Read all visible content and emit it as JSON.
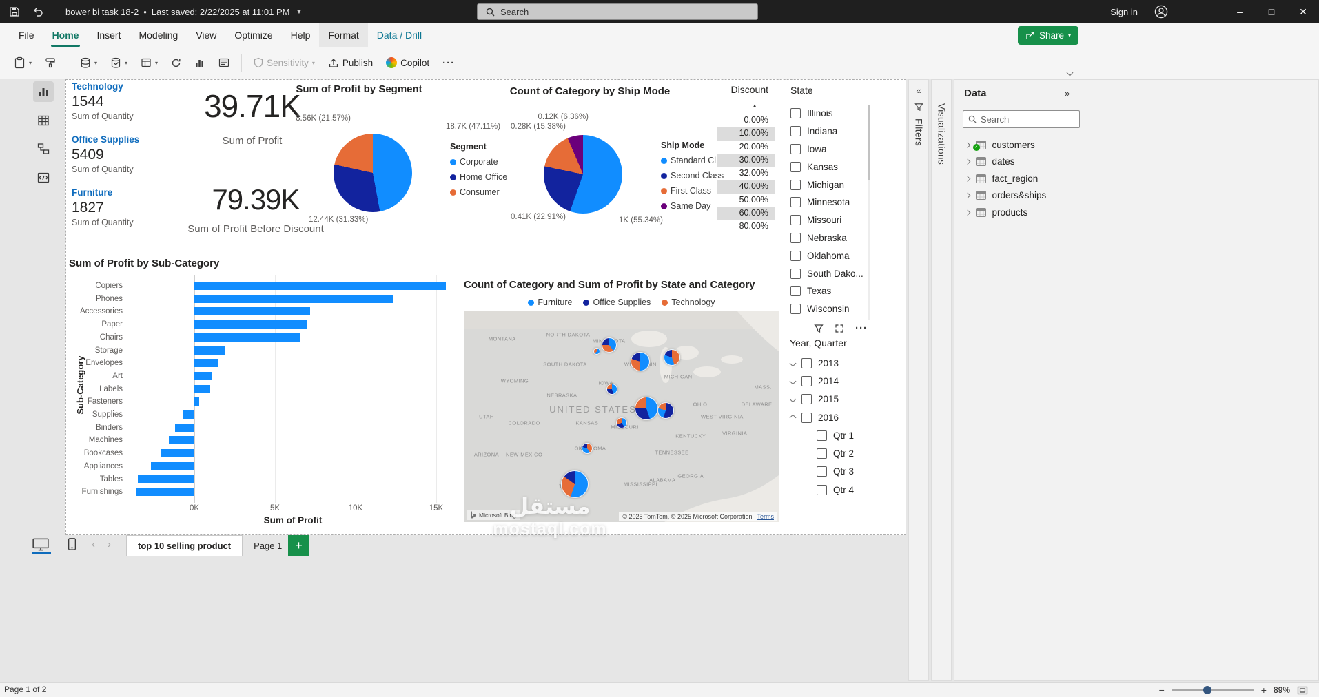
{
  "titlebar": {
    "title": "bower bi task 18-2",
    "separator": "•",
    "last_saved": "Last saved: 2/22/2025 at 11:01 PM",
    "search_placeholder": "Search",
    "sign_in": "Sign in"
  },
  "ribbon": {
    "tabs": [
      {
        "label": "File"
      },
      {
        "label": "Home",
        "active": true
      },
      {
        "label": "Insert"
      },
      {
        "label": "Modeling"
      },
      {
        "label": "View"
      },
      {
        "label": "Optimize"
      },
      {
        "label": "Help"
      },
      {
        "label": "Format",
        "contextual": true
      },
      {
        "label": "Data / Drill",
        "contextual_text": true
      }
    ],
    "share_label": "Share"
  },
  "toolbar": {
    "sensitivity_label": "Sensitivity",
    "publish_label": "Publish",
    "copilot_label": "Copilot"
  },
  "category_cards": [
    {
      "title": "Technology",
      "value": "1544",
      "label": "Sum of Quantity"
    },
    {
      "title": "Office Supplies",
      "value": "5409",
      "label": "Sum of Quantity"
    },
    {
      "title": "Furniture",
      "value": "1827",
      "label": "Sum of Quantity"
    }
  ],
  "kpi_cards": [
    {
      "value": "39.71K",
      "label": "Sum of Profit"
    },
    {
      "value": "79.39K",
      "label": "Sum of Profit Before Discount"
    }
  ],
  "chart_data": [
    {
      "type": "pie",
      "title": "Sum of Profit by Segment",
      "legend_title": "Segment",
      "legend_position": "right",
      "slices": [
        {
          "label": "Corporate",
          "value": 18.7,
          "pct": 47.11,
          "value_label": "18.7K (47.11%)",
          "color": "#118DFF"
        },
        {
          "label": "Home Office",
          "value": 12.44,
          "pct": 31.33,
          "value_label": "12.44K (31.33%)",
          "color": "#12239E"
        },
        {
          "label": "Consumer",
          "value": 8.56,
          "pct": 21.57,
          "value_label": "8.56K (21.57%)",
          "color": "#E66C37"
        }
      ]
    },
    {
      "type": "pie",
      "title": "Count of Category by Ship Mode",
      "legend_title": "Ship Mode",
      "legend_position": "right",
      "slices": [
        {
          "label": "Standard Cl...",
          "value": 1.0,
          "pct": 55.34,
          "value_label": "1K (55.34%)",
          "color": "#118DFF"
        },
        {
          "label": "Second Class",
          "value": 0.41,
          "pct": 22.91,
          "value_label": "0.41K (22.91%)",
          "color": "#12239E"
        },
        {
          "label": "First Class",
          "value": 0.28,
          "pct": 15.38,
          "value_label": "0.28K (15.38%)",
          "color": "#E66C37"
        },
        {
          "label": "Same Day",
          "value": 0.12,
          "pct": 6.36,
          "value_label": "0.12K (6.36%)",
          "color": "#6B007B"
        }
      ]
    },
    {
      "type": "bar",
      "title": "Sum of Profit by Sub-Category",
      "xlabel": "Sum of Profit",
      "ylabel": "Sub-Category",
      "orientation": "horizontal",
      "bar_color": "#118DFF",
      "ticks": [
        0,
        5,
        10,
        15
      ],
      "tick_suffix": "K",
      "xlim": [
        -4,
        16.5
      ],
      "categories": [
        "Copiers",
        "Phones",
        "Accessories",
        "Paper",
        "Chairs",
        "Storage",
        "Envelopes",
        "Art",
        "Labels",
        "Fasteners",
        "Supplies",
        "Binders",
        "Machines",
        "Bookcases",
        "Appliances",
        "Tables",
        "Furnishings"
      ],
      "values": [
        15.6,
        12.3,
        7.2,
        7.0,
        6.6,
        1.9,
        1.5,
        1.1,
        1.0,
        0.3,
        -0.7,
        -1.2,
        -1.6,
        -2.1,
        -2.7,
        -3.5,
        -3.6
      ]
    },
    {
      "type": "map",
      "title": "Count of Category and Sum of Profit by State and Category",
      "big_label": "UNITED STATES",
      "provider": "Microsoft Bing",
      "attribution": "© 2025 TomTom, © 2025 Microsoft Corporation",
      "terms": "Terms",
      "legend": [
        {
          "label": "Furniture",
          "color": "#118DFF"
        },
        {
          "label": "Office Supplies",
          "color": "#12239E"
        },
        {
          "label": "Technology",
          "color": "#E66C37"
        }
      ],
      "state_labels": [
        {
          "text": "MONTANA",
          "x": 12,
          "y": 13
        },
        {
          "text": "NORTH DAKOTA",
          "x": 33,
          "y": 11
        },
        {
          "text": "MINNESOTA",
          "x": 46,
          "y": 14
        },
        {
          "text": "SOUTH DAKOTA",
          "x": 32,
          "y": 25
        },
        {
          "text": "WISCONSIN",
          "x": 56,
          "y": 25
        },
        {
          "text": "MICHIGAN",
          "x": 68,
          "y": 31
        },
        {
          "text": "WYOMING",
          "x": 16,
          "y": 33
        },
        {
          "text": "IOWA",
          "x": 45,
          "y": 34
        },
        {
          "text": "NEBRASKA",
          "x": 31,
          "y": 40
        },
        {
          "text": "OHIO",
          "x": 75,
          "y": 44
        },
        {
          "text": "UTAH",
          "x": 7,
          "y": 50
        },
        {
          "text": "COLORADO",
          "x": 19,
          "y": 53
        },
        {
          "text": "KANSAS",
          "x": 39,
          "y": 53
        },
        {
          "text": "MISSOURI",
          "x": 51,
          "y": 55
        },
        {
          "text": "KENTUCKY",
          "x": 72,
          "y": 59
        },
        {
          "text": "WEST VIRGINIA",
          "x": 82,
          "y": 50
        },
        {
          "text": "VIRGINIA",
          "x": 86,
          "y": 58
        },
        {
          "text": "DELAWARE",
          "x": 93,
          "y": 44
        },
        {
          "text": "MASS.",
          "x": 95,
          "y": 36
        },
        {
          "text": "ARIZONA",
          "x": 7,
          "y": 68
        },
        {
          "text": "NEW MEXICO",
          "x": 19,
          "y": 68
        },
        {
          "text": "OKLAHOMA",
          "x": 40,
          "y": 65
        },
        {
          "text": "TENNESSEE",
          "x": 66,
          "y": 67
        },
        {
          "text": "MISSISSIPPI",
          "x": 56,
          "y": 82
        },
        {
          "text": "ALABAMA",
          "x": 63,
          "y": 80
        },
        {
          "text": "GEORGIA",
          "x": 72,
          "y": 78
        },
        {
          "text": "TEXAS",
          "x": 33,
          "y": 83
        }
      ],
      "markers": [
        {
          "x": 46,
          "y": 16,
          "d": 22,
          "segments": [
            [
              "#118DFF",
              40
            ],
            [
              "#E66C37",
              35
            ],
            [
              "#12239E",
              25
            ]
          ]
        },
        {
          "x": 42,
          "y": 19,
          "d": 10,
          "segments": [
            [
              "#118DFF",
              60
            ],
            [
              "#E66C37",
              40
            ]
          ]
        },
        {
          "x": 56,
          "y": 24,
          "d": 28,
          "segments": [
            [
              "#118DFF",
              50
            ],
            [
              "#E66C37",
              30
            ],
            [
              "#12239E",
              20
            ]
          ]
        },
        {
          "x": 66,
          "y": 22,
          "d": 24,
          "segments": [
            [
              "#E66C37",
              45
            ],
            [
              "#118DFF",
              35
            ],
            [
              "#12239E",
              20
            ]
          ]
        },
        {
          "x": 47,
          "y": 37,
          "d": 16,
          "segments": [
            [
              "#118DFF",
              45
            ],
            [
              "#12239E",
              30
            ],
            [
              "#E66C37",
              25
            ]
          ]
        },
        {
          "x": 58,
          "y": 46,
          "d": 34,
          "segments": [
            [
              "#118DFF",
              45
            ],
            [
              "#12239E",
              30
            ],
            [
              "#E66C37",
              25
            ]
          ]
        },
        {
          "x": 64,
          "y": 47,
          "d": 24,
          "segments": [
            [
              "#12239E",
              55
            ],
            [
              "#118DFF",
              25
            ],
            [
              "#E66C37",
              20
            ]
          ]
        },
        {
          "x": 50,
          "y": 53,
          "d": 16,
          "segments": [
            [
              "#118DFF",
              40
            ],
            [
              "#12239E",
              30
            ],
            [
              "#E66C37",
              30
            ]
          ]
        },
        {
          "x": 39,
          "y": 65,
          "d": 16,
          "segments": [
            [
              "#E66C37",
              40
            ],
            [
              "#118DFF",
              40
            ],
            [
              "#12239E",
              20
            ]
          ]
        },
        {
          "x": 35,
          "y": 82,
          "d": 40,
          "segments": [
            [
              "#118DFF",
              55
            ],
            [
              "#E66C37",
              30
            ],
            [
              "#12239E",
              15
            ]
          ]
        }
      ]
    }
  ],
  "discount_slicer": {
    "title": "Discount",
    "sort_icon": "▲",
    "values": [
      {
        "label": "0.00%",
        "selected": false
      },
      {
        "label": "10.00%",
        "selected": true
      },
      {
        "label": "20.00%",
        "selected": false
      },
      {
        "label": "30.00%",
        "selected": true
      },
      {
        "label": "32.00%",
        "selected": false
      },
      {
        "label": "40.00%",
        "selected": true
      },
      {
        "label": "50.00%",
        "selected": false
      },
      {
        "label": "60.00%",
        "selected": true
      },
      {
        "label": "80.00%",
        "selected": false
      }
    ]
  },
  "state_slicer": {
    "title": "State",
    "items": [
      "Illinois",
      "Indiana",
      "Iowa",
      "Kansas",
      "Michigan",
      "Minnesota",
      "Missouri",
      "Nebraska",
      "Oklahoma",
      "South Dako...",
      "Texas",
      "Wisconsin"
    ]
  },
  "year_slicer": {
    "title": "Year, Quarter",
    "items": [
      {
        "label": "2013",
        "chevron": "down"
      },
      {
        "label": "2014",
        "chevron": "down"
      },
      {
        "label": "2015",
        "chevron": "down"
      },
      {
        "label": "2016",
        "chevron": "up"
      },
      {
        "label": "Qtr 1",
        "indent": true
      },
      {
        "label": "Qtr 2",
        "indent": true
      },
      {
        "label": "Qtr 3",
        "indent": true
      },
      {
        "label": "Qtr 4",
        "indent": true
      }
    ]
  },
  "panes": {
    "filters_label": "Filters",
    "visualizations_label": "Visualizations",
    "data": {
      "title": "Data",
      "search_placeholder": "Search",
      "tables": [
        {
          "name": "customers",
          "checked": true
        },
        {
          "name": "dates",
          "checked": false
        },
        {
          "name": "fact_region",
          "checked": false
        },
        {
          "name": "orders&ships",
          "checked": false
        },
        {
          "name": "products",
          "checked": false
        }
      ]
    }
  },
  "pages_bar": {
    "tabs": [
      {
        "label": "top 10 selling product",
        "active": true
      },
      {
        "label": "Page 1",
        "active": false
      }
    ]
  },
  "statusbar": {
    "page_info": "Page 1 of 2",
    "zoom": "89%"
  },
  "watermark": {
    "line1": "مستقل",
    "line2": "mostaql.com"
  }
}
